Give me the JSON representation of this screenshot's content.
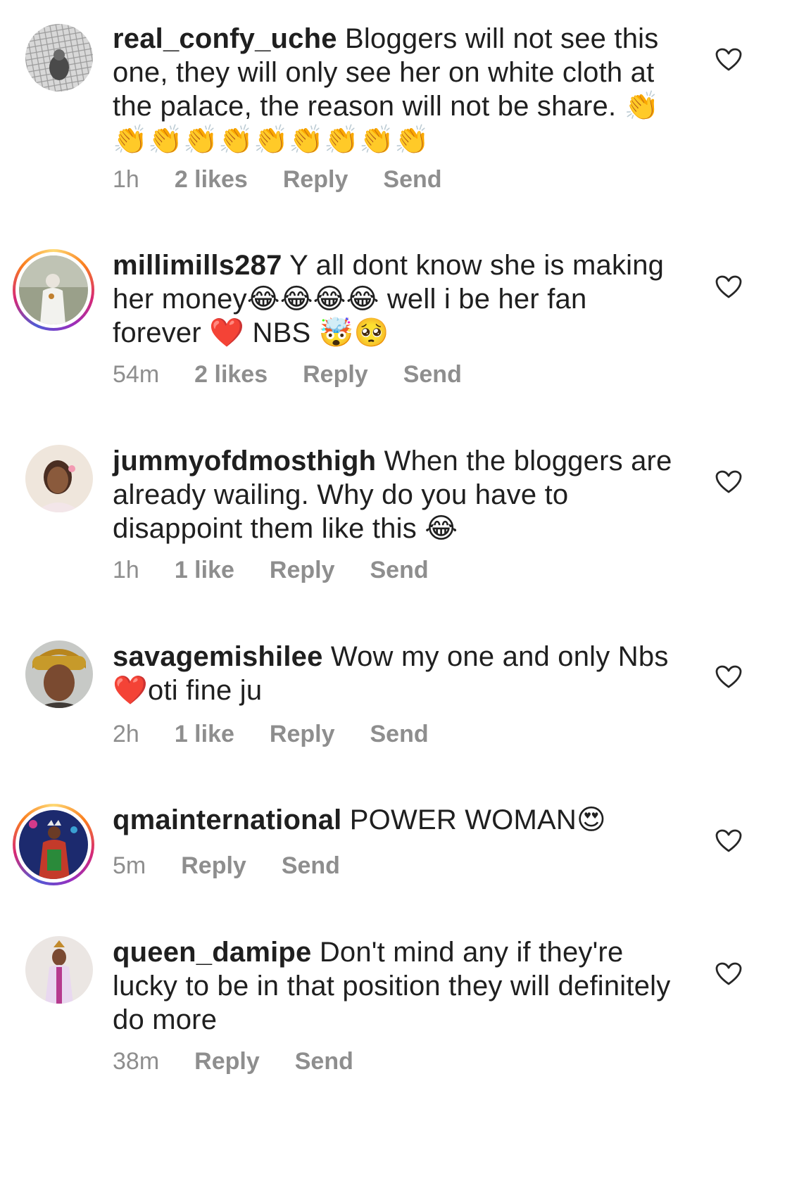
{
  "ui": {
    "reply_label": "Reply",
    "send_label": "Send",
    "colors": {
      "text": "#1f1f1f",
      "meta": "#8e8e8e",
      "story_ring": [
        "#feda75",
        "#fa7e1e",
        "#d62976",
        "#962fbf",
        "#4f5bd5"
      ]
    }
  },
  "comments": [
    {
      "username": "real_confy_uche",
      "text": "Bloggers will not see this one, they will only see her on white cloth at the palace, the reason will not be share. 👏👏👏👏👏👏👏👏👏👏",
      "time": "1h",
      "likes": "2 likes",
      "story_ring": false,
      "avatar_icon": "grayscale-photo-avatar"
    },
    {
      "username": "millimills287",
      "text": "Y all dont know she is making her money😂😂😂😂 well i be her fan forever ❤️ NBS 🤯🥺",
      "time": "54m",
      "likes": "2 likes",
      "story_ring": true,
      "avatar_icon": "photo-avatar"
    },
    {
      "username": "jummyofdmosthigh",
      "text": "When the bloggers are already wailing. Why do you have to disappoint them like this 😂",
      "time": "1h",
      "likes": "1 like",
      "story_ring": false,
      "avatar_icon": "photo-avatar"
    },
    {
      "username": "savagemishilee",
      "text": "Wow my one and only Nbs ❤️oti fine ju",
      "time": "2h",
      "likes": "1 like",
      "story_ring": false,
      "avatar_icon": "photo-avatar"
    },
    {
      "username": "qmainternational",
      "text": "POWER WOMAN😍",
      "time": "5m",
      "likes": "",
      "story_ring": true,
      "avatar_icon": "photo-avatar"
    },
    {
      "username": "queen_damipe",
      "text": "Don't mind any if they're lucky to be in that position they will definitely do more",
      "time": "38m",
      "likes": "",
      "story_ring": false,
      "avatar_icon": "photo-avatar"
    }
  ]
}
